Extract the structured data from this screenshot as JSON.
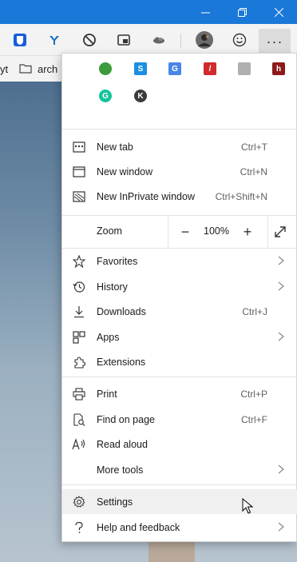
{
  "window": {
    "minimize_icon": "minimize-icon",
    "restore_icon": "restore-icon",
    "close_icon": "close-icon"
  },
  "toolbar": {
    "extensions": [
      {
        "name": "bitwarden-icon",
        "color": "#175ddc",
        "glyph": "U"
      },
      {
        "name": "vpn-icon",
        "color": "#1d6fb8",
        "glyph": "Y"
      },
      {
        "name": "block-icon",
        "color": "#333333",
        "glyph": "⊘"
      },
      {
        "name": "picture-in-picture-icon",
        "color": "#333333",
        "glyph": "▣"
      },
      {
        "name": "cloud-icon",
        "color": "#555555",
        "glyph": "☁"
      }
    ],
    "avatar": "profile-avatar",
    "emoji_icon": "emoji-icon",
    "more_label": "···"
  },
  "favbar": {
    "left_text": "yt",
    "folder_label": "arch"
  },
  "menu": {
    "extension_icons": [
      {
        "name": "ext-green-icon",
        "color": "#3c9a3c"
      },
      {
        "name": "ext-skype-icon",
        "color": "#1a8fe0"
      },
      {
        "name": "ext-translate-icon",
        "color": "#4a86e8"
      },
      {
        "name": "ext-pdf-icon",
        "color": "#d22b2b"
      },
      {
        "name": "ext-grey-icon",
        "color": "#8a8a8a"
      },
      {
        "name": "ext-red-dark-icon",
        "color": "#8b1a1a"
      },
      {
        "name": "ext-grammarly-icon",
        "color": "#15c39a"
      },
      {
        "name": "ext-k-icon",
        "color": "#3b3b3b"
      }
    ],
    "new_tab": {
      "label": "New tab",
      "shortcut": "Ctrl+T"
    },
    "new_window": {
      "label": "New window",
      "shortcut": "Ctrl+N"
    },
    "new_inprivate": {
      "label": "New InPrivate window",
      "shortcut": "Ctrl+Shift+N"
    },
    "zoom": {
      "label": "Zoom",
      "value": "100%",
      "minus": "−",
      "plus": "+"
    },
    "favorites": {
      "label": "Favorites"
    },
    "history": {
      "label": "History"
    },
    "downloads": {
      "label": "Downloads",
      "shortcut": "Ctrl+J"
    },
    "apps": {
      "label": "Apps"
    },
    "extensions": {
      "label": "Extensions"
    },
    "print": {
      "label": "Print",
      "shortcut": "Ctrl+P"
    },
    "find": {
      "label": "Find on page",
      "shortcut": "Ctrl+F"
    },
    "read_aloud": {
      "label": "Read aloud"
    },
    "more_tools": {
      "label": "More tools"
    },
    "settings": {
      "label": "Settings"
    },
    "help": {
      "label": "Help and feedback"
    }
  },
  "colors": {
    "titlebar": "#1a78d8",
    "menu_bg": "#ffffff",
    "hover_bg": "#f0f0f0"
  }
}
